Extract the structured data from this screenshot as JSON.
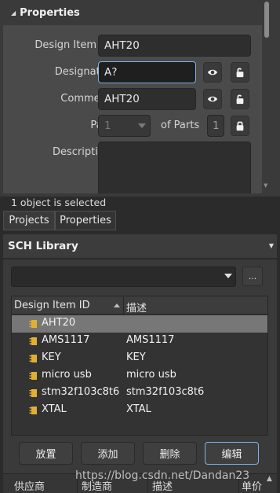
{
  "properties": {
    "title": "Properties",
    "fields": {
      "design_item_id": {
        "label": "Design Item ID",
        "value": "AHT20"
      },
      "designator": {
        "label": "Designator",
        "value": "A?"
      },
      "comment": {
        "label": "Comment",
        "value": "AHT20"
      },
      "part": {
        "label": "Part",
        "value": "1",
        "of_parts_label": "of Parts",
        "of_parts_value": "1"
      },
      "description": {
        "label": "Description",
        "value": ""
      }
    },
    "status": "1 object is selected"
  },
  "tabs": [
    {
      "label": "Projects"
    },
    {
      "label": "Properties"
    }
  ],
  "library": {
    "title": "SCH Library",
    "search_value": "",
    "more_label": "...",
    "columns": {
      "id": "Design Item ID",
      "desc": "描述"
    },
    "rows": [
      {
        "id": "AHT20",
        "desc": ""
      },
      {
        "id": "AMS1117",
        "desc": "AMS1117"
      },
      {
        "id": "KEY",
        "desc": "KEY"
      },
      {
        "id": "micro usb",
        "desc": "micro usb"
      },
      {
        "id": "stm32f103c8t6",
        "desc": "stm32f103c8t6"
      },
      {
        "id": "XTAL",
        "desc": "XTAL"
      }
    ],
    "selected_index": 0,
    "buttons": {
      "place": "放置",
      "add": "添加",
      "delete": "删除",
      "edit": "编辑"
    },
    "bottom_columns": [
      "供应商",
      "制造商",
      "描述",
      "单价"
    ]
  },
  "watermark": "https://blog.csdn.net/Dandan23",
  "colors": {
    "accent": "#7ab3e8",
    "selection": "#777777",
    "component_icon": "#e0b030"
  }
}
